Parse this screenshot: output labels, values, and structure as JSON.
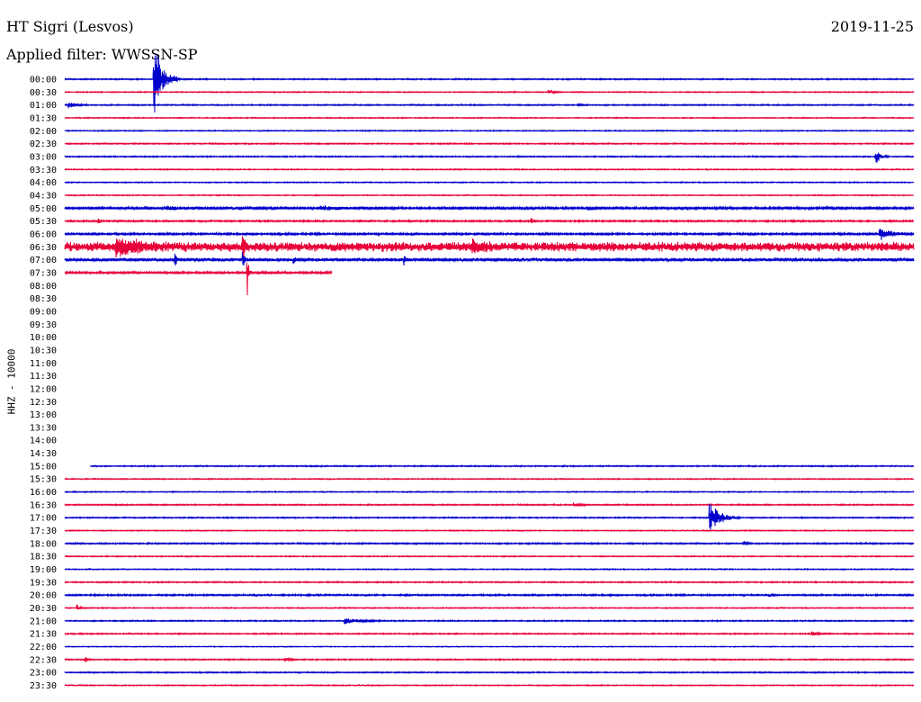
{
  "header": {
    "station": "HT Sigri (Lesvos)",
    "date": "2019-11-25",
    "filter": "Applied filter: WWSSN-SP"
  },
  "chart_data": {
    "type": "line",
    "ylabel": "HHZ - 10000",
    "colors": [
      "#0000cc",
      "#e8003a"
    ],
    "row_labels": [
      "00:00",
      "00:30",
      "01:00",
      "01:30",
      "02:00",
      "02:30",
      "03:00",
      "03:30",
      "04:00",
      "04:30",
      "05:00",
      "05:30",
      "06:00",
      "06:30",
      "07:00",
      "07:30",
      "08:00",
      "08:30",
      "09:00",
      "09:30",
      "10:00",
      "10:30",
      "11:00",
      "11:30",
      "12:00",
      "12:30",
      "13:00",
      "13:30",
      "14:00",
      "14:30",
      "15:00",
      "15:30",
      "16:00",
      "16:30",
      "17:00",
      "17:30",
      "18:00",
      "18:30",
      "19:00",
      "19:30",
      "20:00",
      "20:30",
      "21:00",
      "21:30",
      "22:00",
      "22:30",
      "23:00",
      "23:30"
    ],
    "rows": [
      {
        "time": "00:00",
        "start": 0,
        "end": 1,
        "noise": 0.6,
        "events": [
          {
            "pos": 0.105,
            "amp": 40,
            "dur": 0.03
          }
        ]
      },
      {
        "time": "00:30",
        "start": 0,
        "end": 1,
        "noise": 0.5,
        "events": [
          {
            "pos": 0.57,
            "amp": 3,
            "dur": 0.015
          }
        ]
      },
      {
        "time": "01:00",
        "start": 0,
        "end": 1,
        "noise": 0.6,
        "events": [
          {
            "pos": 0.005,
            "amp": 4,
            "dur": 0.02
          },
          {
            "pos": 0.605,
            "amp": 2,
            "dur": 0.01
          }
        ]
      },
      {
        "time": "01:30",
        "start": 0,
        "end": 1,
        "noise": 0.5,
        "events": []
      },
      {
        "time": "02:00",
        "start": 0,
        "end": 1,
        "noise": 0.5,
        "events": []
      },
      {
        "time": "02:30",
        "start": 0,
        "end": 1,
        "noise": 0.6,
        "events": []
      },
      {
        "time": "03:00",
        "start": 0,
        "end": 1,
        "noise": 0.6,
        "events": [
          {
            "pos": 0.955,
            "amp": 9,
            "dur": 0.015
          }
        ]
      },
      {
        "time": "03:30",
        "start": 0,
        "end": 1,
        "noise": 0.5,
        "events": []
      },
      {
        "time": "04:00",
        "start": 0,
        "end": 1,
        "noise": 0.5,
        "events": []
      },
      {
        "time": "04:30",
        "start": 0,
        "end": 1,
        "noise": 0.5,
        "events": []
      },
      {
        "time": "05:00",
        "start": 0,
        "end": 1,
        "noise": 1.2,
        "events": [
          {
            "pos": 0.12,
            "amp": 2,
            "dur": 0.08
          },
          {
            "pos": 0.3,
            "amp": 2,
            "dur": 0.09
          }
        ]
      },
      {
        "time": "05:30",
        "start": 0,
        "end": 1,
        "noise": 0.8,
        "events": [
          {
            "pos": 0.04,
            "amp": 3,
            "dur": 0.005
          },
          {
            "pos": 0.55,
            "amp": 3,
            "dur": 0.005
          }
        ]
      },
      {
        "time": "06:00",
        "start": 0,
        "end": 1,
        "noise": 1.0,
        "events": [
          {
            "pos": 0.96,
            "amp": 6,
            "dur": 0.04
          }
        ]
      },
      {
        "time": "06:30",
        "start": 0,
        "end": 1,
        "noise": 4.5,
        "events": [
          {
            "pos": 0.06,
            "amp": 9,
            "dur": 0.08
          },
          {
            "pos": 0.21,
            "amp": 20,
            "dur": 0.005
          },
          {
            "pos": 0.48,
            "amp": 6,
            "dur": 0.04
          }
        ]
      },
      {
        "time": "07:00",
        "start": 0,
        "end": 1,
        "noise": 1.5,
        "events": [
          {
            "pos": 0.13,
            "amp": 14,
            "dur": 0.004
          },
          {
            "pos": 0.21,
            "amp": 12,
            "dur": 0.004
          },
          {
            "pos": 0.27,
            "amp": 6,
            "dur": 0.004
          },
          {
            "pos": 0.4,
            "amp": 7,
            "dur": 0.004
          }
        ]
      },
      {
        "time": "07:30",
        "start": 0,
        "end": 0.315,
        "noise": 1.0,
        "events": [
          {
            "pos": 0.215,
            "amp": 32,
            "dur": 0.004
          }
        ]
      },
      {
        "time": "08:00",
        "start": 0,
        "end": 0,
        "noise": 0,
        "events": []
      },
      {
        "time": "08:30",
        "start": 0,
        "end": 0,
        "noise": 0,
        "events": []
      },
      {
        "time": "09:00",
        "start": 0,
        "end": 0,
        "noise": 0,
        "events": []
      },
      {
        "time": "09:30",
        "start": 0,
        "end": 0,
        "noise": 0,
        "events": []
      },
      {
        "time": "10:00",
        "start": 0,
        "end": 0,
        "noise": 0,
        "events": []
      },
      {
        "time": "10:30",
        "start": 0,
        "end": 0,
        "noise": 0,
        "events": []
      },
      {
        "time": "11:00",
        "start": 0,
        "end": 0,
        "noise": 0,
        "events": []
      },
      {
        "time": "11:30",
        "start": 0,
        "end": 0,
        "noise": 0,
        "events": []
      },
      {
        "time": "12:00",
        "start": 0,
        "end": 0,
        "noise": 0,
        "events": []
      },
      {
        "time": "12:30",
        "start": 0,
        "end": 0,
        "noise": 0,
        "events": []
      },
      {
        "time": "13:00",
        "start": 0,
        "end": 0,
        "noise": 0,
        "events": []
      },
      {
        "time": "13:30",
        "start": 0,
        "end": 0,
        "noise": 0,
        "events": []
      },
      {
        "time": "14:00",
        "start": 0,
        "end": 0,
        "noise": 0,
        "events": []
      },
      {
        "time": "14:30",
        "start": 0,
        "end": 0,
        "noise": 0,
        "events": []
      },
      {
        "time": "15:00",
        "start": 0.03,
        "end": 1,
        "noise": 0.6,
        "events": []
      },
      {
        "time": "15:30",
        "start": 0,
        "end": 1,
        "noise": 0.5,
        "events": []
      },
      {
        "time": "16:00",
        "start": 0,
        "end": 1,
        "noise": 0.5,
        "events": []
      },
      {
        "time": "16:30",
        "start": 0,
        "end": 1,
        "noise": 0.6,
        "events": [
          {
            "pos": 0.6,
            "amp": 2,
            "dur": 0.02
          }
        ]
      },
      {
        "time": "17:00",
        "start": 0,
        "end": 1,
        "noise": 0.6,
        "events": [
          {
            "pos": 0.76,
            "amp": 16,
            "dur": 0.035
          }
        ]
      },
      {
        "time": "17:30",
        "start": 0,
        "end": 1,
        "noise": 0.5,
        "events": []
      },
      {
        "time": "18:00",
        "start": 0,
        "end": 1,
        "noise": 0.7,
        "events": [
          {
            "pos": 0.8,
            "amp": 2,
            "dur": 0.01
          }
        ]
      },
      {
        "time": "18:30",
        "start": 0,
        "end": 1,
        "noise": 0.5,
        "events": []
      },
      {
        "time": "19:00",
        "start": 0,
        "end": 1,
        "noise": 0.5,
        "events": []
      },
      {
        "time": "19:30",
        "start": 0,
        "end": 1,
        "noise": 0.6,
        "events": []
      },
      {
        "time": "20:00",
        "start": 0,
        "end": 1,
        "noise": 0.8,
        "events": [
          {
            "pos": 0.83,
            "amp": 2,
            "dur": 0.01
          }
        ]
      },
      {
        "time": "20:30",
        "start": 0,
        "end": 1,
        "noise": 0.5,
        "events": [
          {
            "pos": 0.015,
            "amp": 3,
            "dur": 0.01
          }
        ]
      },
      {
        "time": "21:00",
        "start": 0,
        "end": 1,
        "noise": 0.6,
        "events": [
          {
            "pos": 0.33,
            "amp": 3,
            "dur": 0.05
          }
        ]
      },
      {
        "time": "21:30",
        "start": 0,
        "end": 1,
        "noise": 0.6,
        "events": [
          {
            "pos": 0.88,
            "amp": 2,
            "dur": 0.025
          }
        ]
      },
      {
        "time": "22:00",
        "start": 0,
        "end": 1,
        "noise": 0.4,
        "events": []
      },
      {
        "time": "22:30",
        "start": 0,
        "end": 1,
        "noise": 0.6,
        "events": [
          {
            "pos": 0.025,
            "amp": 4,
            "dur": 0.005
          },
          {
            "pos": 0.26,
            "amp": 2,
            "dur": 0.015
          }
        ]
      },
      {
        "time": "23:00",
        "start": 0,
        "end": 1,
        "noise": 0.6,
        "events": []
      },
      {
        "time": "23:30",
        "start": 0,
        "end": 1,
        "noise": 0.5,
        "events": []
      }
    ]
  }
}
